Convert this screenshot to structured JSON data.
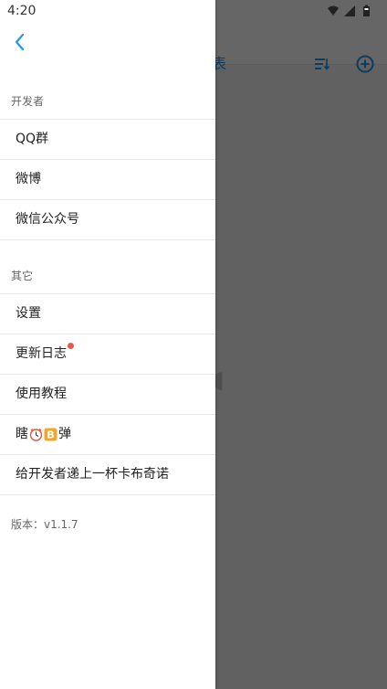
{
  "status_bar": {
    "time": "4:20"
  },
  "background_app": {
    "title_fragment": "表",
    "accent_color": "#2196f3"
  },
  "drawer": {
    "sections": [
      {
        "header": "开发者",
        "items": [
          {
            "label": "QQ群"
          },
          {
            "label": "微博"
          },
          {
            "label": "微信公众号"
          }
        ]
      },
      {
        "header": "其它",
        "items": [
          {
            "label": "设置"
          },
          {
            "label": "更新日志",
            "badge": "red-dot"
          },
          {
            "label": "使用教程"
          },
          {
            "label_prefix": "瞎",
            "label_suffix": "弹",
            "icons": [
              "clock-emoji-icon",
              "bitcoin-emoji-icon"
            ]
          },
          {
            "label": "给开发者递上一杯卡布奇诺"
          }
        ]
      }
    ],
    "version": "版本：v1.1.7",
    "badge_color": "#e8574a"
  }
}
